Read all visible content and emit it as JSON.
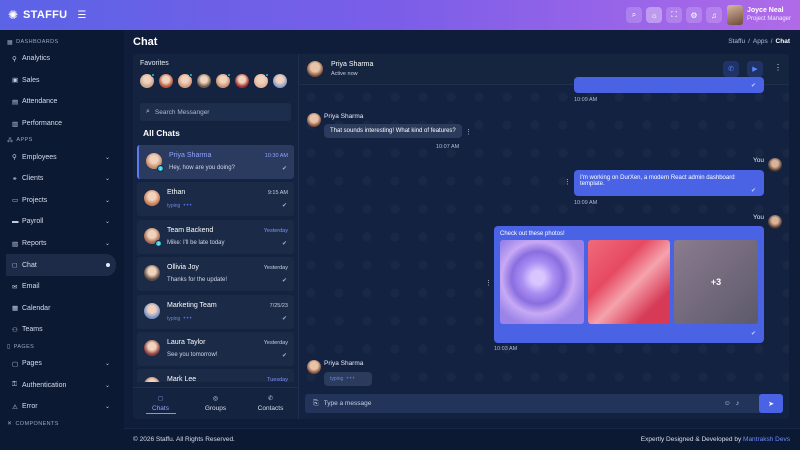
{
  "topbar": {
    "brand": "STAFFU",
    "user_name": "Joyce Neal",
    "user_role": "Project Manager",
    "icons": [
      "search-icon",
      "theme-icon",
      "fullscreen-icon",
      "settings-icon",
      "notification-icon"
    ]
  },
  "sidebar": {
    "dashboards_label": "DASHBOARDS",
    "apps_label": "APPS",
    "pages_label": "PAGES",
    "components_label": "COMPONENTS",
    "dashboards": [
      {
        "label": "Analytics",
        "icon": "users-icon"
      },
      {
        "label": "Sales",
        "icon": "store-icon"
      },
      {
        "label": "Attendance",
        "icon": "calendar-check-icon"
      },
      {
        "label": "Performance",
        "icon": "chart-icon"
      }
    ],
    "apps": [
      {
        "label": "Employees",
        "icon": "users-icon",
        "expandable": true
      },
      {
        "label": "Clients",
        "icon": "handshake-icon",
        "expandable": true
      },
      {
        "label": "Projects",
        "icon": "folder-icon",
        "expandable": true
      },
      {
        "label": "Payroll",
        "icon": "wallet-icon",
        "expandable": true
      },
      {
        "label": "Reports",
        "icon": "report-icon",
        "expandable": true
      },
      {
        "label": "Chat",
        "icon": "chat-icon",
        "active": true
      },
      {
        "label": "Email",
        "icon": "mail-icon"
      },
      {
        "label": "Calendar",
        "icon": "calendar-icon"
      },
      {
        "label": "Teams",
        "icon": "team-icon"
      }
    ],
    "pages": [
      {
        "label": "Pages",
        "icon": "pages-icon",
        "expandable": true
      },
      {
        "label": "Authentication",
        "icon": "lock-icon",
        "expandable": true
      },
      {
        "label": "Error",
        "icon": "error-icon",
        "expandable": true
      }
    ]
  },
  "page": {
    "title": "Chat",
    "breadcrumb": [
      "Staffu",
      "Apps",
      "Chat"
    ],
    "breadcrumb_sep": "/"
  },
  "chatlist": {
    "favorites_title": "Favorites",
    "favorite_count": 8,
    "search_placeholder": "Search Messanger",
    "all_chats_title": "All Chats",
    "conversations": [
      {
        "name": "Priya Sharma",
        "time": "10:30 AM",
        "message": "Hey, how are you doing?",
        "active": true,
        "badge": "2",
        "avatar_color": "#c98b6b"
      },
      {
        "name": "Ethan",
        "time": "9:15 AM",
        "message": "typing",
        "typing": true,
        "avatar_color": "#c97a55"
      },
      {
        "name": "Team Backend",
        "time": "Yesterday",
        "message": "Mike: I'll be late today",
        "badge": "3",
        "time_highlight": true,
        "avatar_color": "#a66a50"
      },
      {
        "name": "Ollivia Joy",
        "time": "Yesterday",
        "message": "Thanks for the update!",
        "avatar_color": "#5a4a45"
      },
      {
        "name": "Marketing Team",
        "time": "7/25/23",
        "message": "typing",
        "typing": true,
        "avatar_color": "#7a93c8"
      },
      {
        "name": "Laura Taylor",
        "time": "Yesterday",
        "message": "See you tomorrow!",
        "avatar_color": "#8a3a3a"
      },
      {
        "name": "Mark Lee",
        "time": "Tuesday",
        "message": "",
        "time_highlight": true,
        "avatar_color": "#b07a5a"
      }
    ],
    "tabs": [
      {
        "label": "Chats",
        "icon": "chat-icon",
        "active": true
      },
      {
        "label": "Groups",
        "icon": "groups-icon"
      },
      {
        "label": "Contacts",
        "icon": "phone-icon"
      }
    ]
  },
  "chat": {
    "contact_name": "Priya Sharma",
    "contact_status": "Active now",
    "messages": {
      "top_time": "10:09 AM",
      "in1_sender": "Priya Sharma",
      "in1_text": "That sounds interesting! What kind of features?",
      "in1_time": "10:07 AM",
      "out1_sender": "You",
      "out1_text": "I'm working on DurXen, a modern React admin dashboard template.",
      "out1_time": "10:09 AM",
      "out2_sender": "You",
      "out2_text": "Check out these photos!",
      "out2_more": "+3",
      "out2_time": "10:03 AM",
      "in2_sender": "Priya Sharma",
      "in2_typing": "typing"
    },
    "composer_placeholder": "Type a message"
  },
  "footer": {
    "copyright": "© 2026 Staffu. All Rights Reserved.",
    "credit_prefix": "Expertly Designed & Developed by",
    "credit_link": "Mantraksh Devs"
  },
  "colors": {
    "accent": "#4a63e4",
    "online": "#28c2d6",
    "background": "#0f1d3a"
  }
}
